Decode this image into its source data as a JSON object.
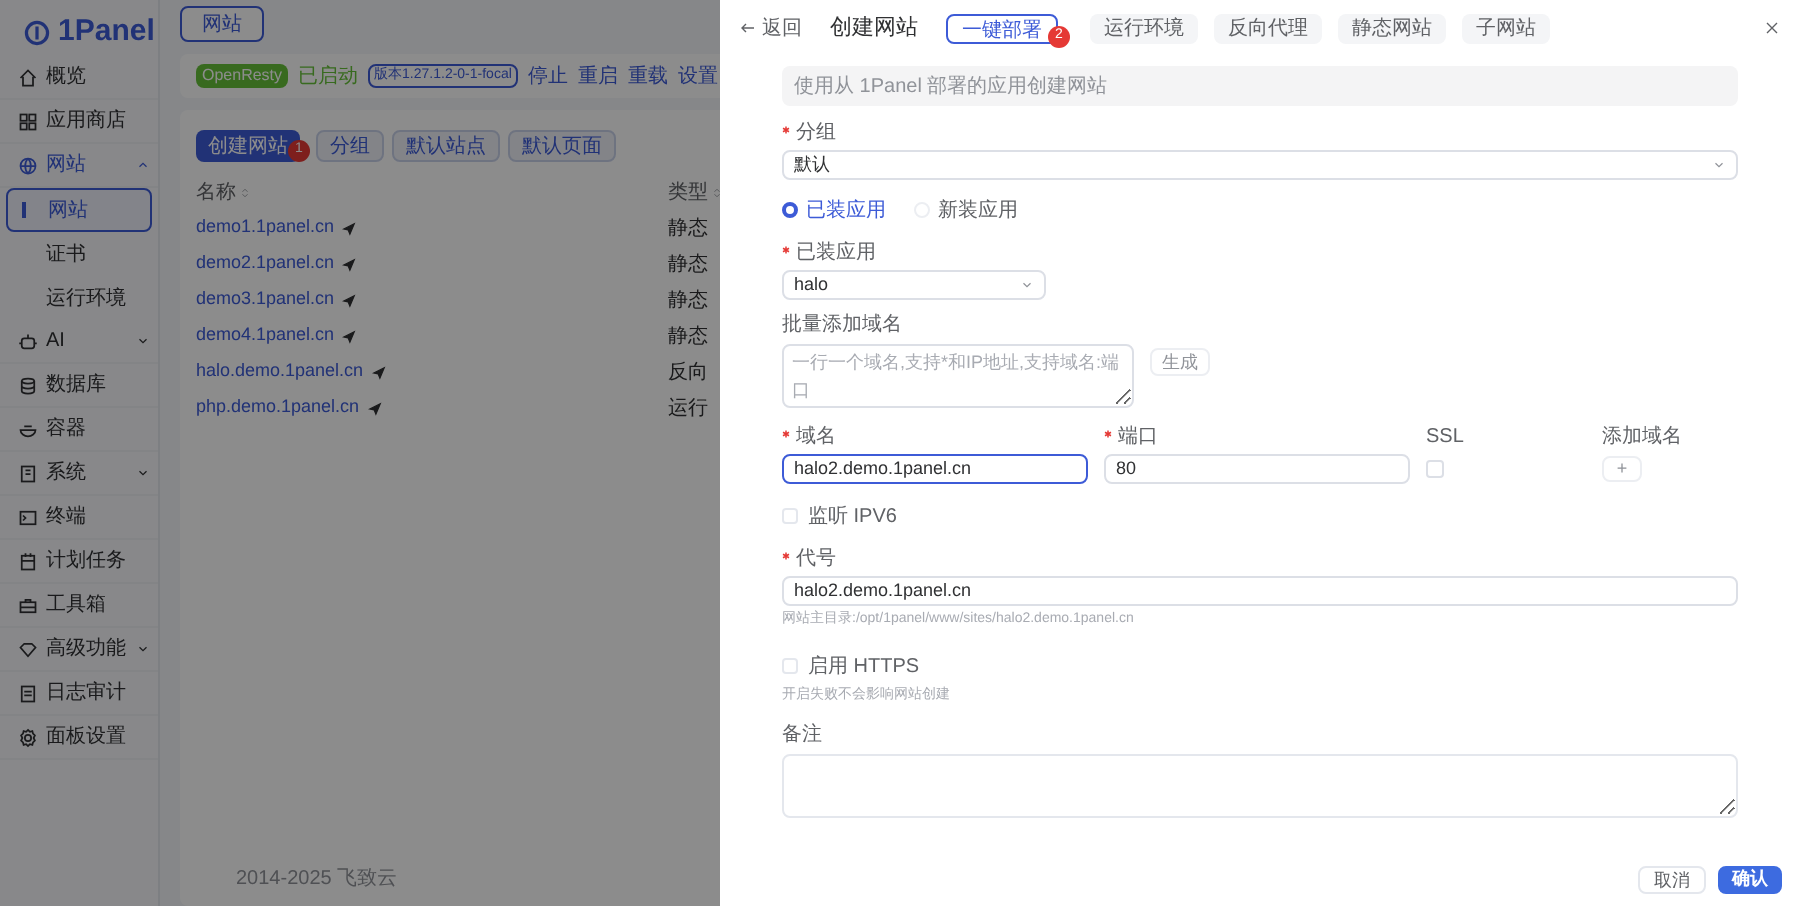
{
  "sidebar": {
    "logo": "1Panel",
    "items": [
      {
        "label": "概览",
        "expandable": false,
        "expanded": false
      },
      {
        "label": "应用商店",
        "expandable": false,
        "expanded": false
      },
      {
        "label": "网站",
        "expandable": true,
        "expanded": true,
        "children": [
          {
            "label": "网站",
            "selected": true
          },
          {
            "label": "证书",
            "selected": false
          },
          {
            "label": "运行环境",
            "selected": false
          }
        ]
      },
      {
        "label": "AI",
        "expandable": true,
        "expanded": false
      },
      {
        "label": "数据库",
        "expandable": false,
        "expanded": false
      },
      {
        "label": "容器",
        "expandable": false,
        "expanded": false
      },
      {
        "label": "系统",
        "expandable": true,
        "expanded": false
      },
      {
        "label": "终端",
        "expandable": false,
        "expanded": false
      },
      {
        "label": "计划任务",
        "expandable": false,
        "expanded": false
      },
      {
        "label": "工具箱",
        "expandable": false,
        "expanded": false
      },
      {
        "label": "高级功能",
        "expandable": true,
        "expanded": false
      },
      {
        "label": "日志审计",
        "expandable": false,
        "expanded": false
      },
      {
        "label": "面板设置",
        "expandable": false,
        "expanded": false
      }
    ],
    "footer": "2014-2025 飞致云"
  },
  "main": {
    "page_tab": "网站",
    "app_bar": {
      "name": "OpenResty",
      "status": "已启动",
      "version": "版本1.27.1.2-0-1-focal",
      "actions": [
        "停止",
        "重启",
        "重载",
        "设置"
      ]
    },
    "toolbar": [
      {
        "label": "创建网站",
        "primary": true,
        "badge": "1"
      },
      {
        "label": "分组",
        "primary": false
      },
      {
        "label": "默认站点",
        "primary": false
      },
      {
        "label": "默认页面",
        "primary": false
      }
    ],
    "table": {
      "columns": [
        "名称",
        "类型"
      ],
      "rows": [
        [
          "demo1.1panel.cn",
          "静态"
        ],
        [
          "demo2.1panel.cn",
          "静态"
        ],
        [
          "demo3.1panel.cn",
          "静态"
        ],
        [
          "demo4.1panel.cn",
          "静态"
        ],
        [
          "halo.demo.1panel.cn",
          "反向"
        ],
        [
          "php.demo.1panel.cn",
          "运行"
        ]
      ]
    }
  },
  "drawer": {
    "back": "返回",
    "title": "创建网站",
    "tabs": [
      {
        "label": "一键部署",
        "selected": true,
        "badge": "2"
      },
      {
        "label": "运行环境",
        "selected": false
      },
      {
        "label": "反向代理",
        "selected": false
      },
      {
        "label": "静态网站",
        "selected": false
      },
      {
        "label": "子网站",
        "selected": false
      }
    ],
    "alert": "使用从 1Panel 部署的应用创建网站",
    "group": {
      "label": "分组",
      "required": true,
      "value": "默认"
    },
    "app_source": [
      {
        "label": "已装应用",
        "selected": true
      },
      {
        "label": "新装应用",
        "selected": false
      }
    ],
    "installed_app": {
      "label": "已装应用",
      "required": true,
      "value": "halo"
    },
    "batch_domains": {
      "label": "批量添加域名",
      "required": false,
      "placeholder": "一行一个域名,支持*和IP地址,支持域名:端口",
      "button": "生成"
    },
    "domain": {
      "label": "域名",
      "required": true,
      "value": "halo2.demo.1panel.cn"
    },
    "port": {
      "label": "端口",
      "required": true,
      "value": "80"
    },
    "ssl": {
      "label": "SSL",
      "required": false,
      "checked": false
    },
    "add_domain": {
      "label": "添加域名",
      "required": false,
      "button": "+"
    },
    "ipv6": {
      "label": "监听 IPV6",
      "checked": false
    },
    "alias": {
      "label": "代号",
      "required": true,
      "value": "halo2.demo.1panel.cn",
      "hint": "网站主目录:/opt/1panel/www/sites/halo2.demo.1panel.cn"
    },
    "https": {
      "label": "启用 HTTPS",
      "checked": false,
      "hint": "开启失败不会影响网站创建"
    },
    "remark": {
      "label": "备注",
      "required": false
    },
    "buttons": [
      {
        "label": "取消",
        "primary": false
      },
      {
        "label": "确认",
        "primary": true
      }
    ]
  }
}
